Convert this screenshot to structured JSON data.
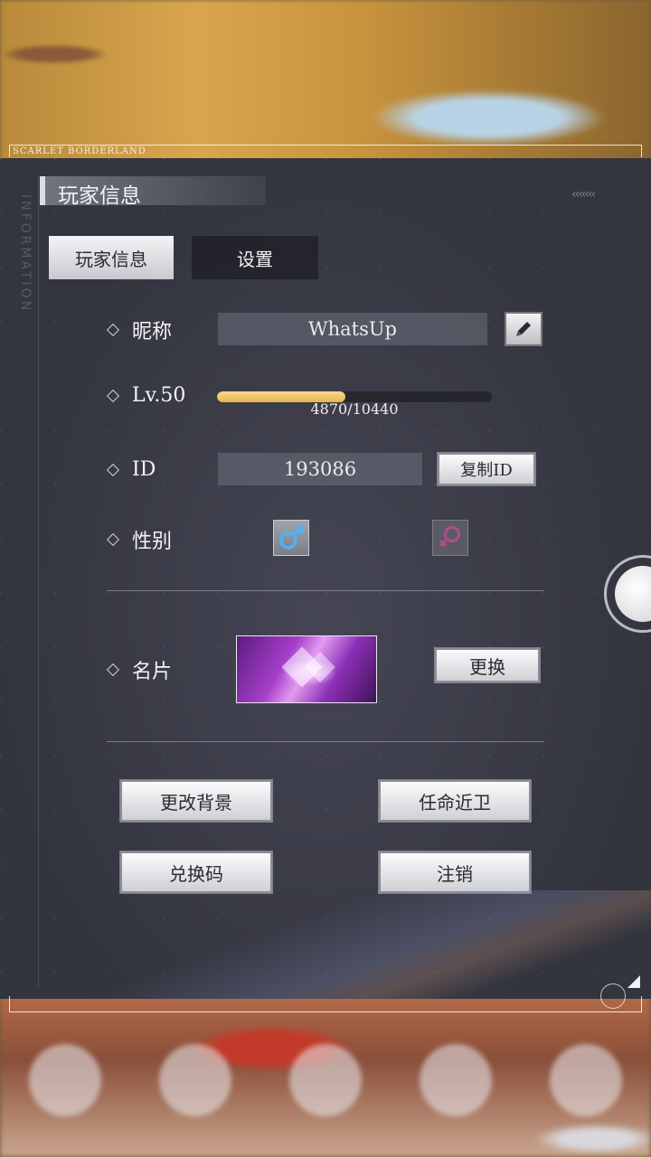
{
  "brand": "SCARLET BORDERLAND",
  "side_text": "INFORMATION",
  "panel": {
    "title": "玩家信息"
  },
  "tabs": [
    {
      "label": "玩家信息",
      "active": true
    },
    {
      "label": "设置",
      "active": false
    }
  ],
  "nickname": {
    "label": "昵称",
    "value": "WhatsUp",
    "edit_icon": "pencil-icon"
  },
  "level": {
    "label": "Lv.50",
    "exp_text": "4870/10440",
    "exp_current": 4870,
    "exp_max": 10440
  },
  "id_row": {
    "label": "ID",
    "value": "193086",
    "copy_label": "复制ID"
  },
  "gender": {
    "label": "性别",
    "male_icon": "male-symbol-icon",
    "female_icon": "female-symbol-icon",
    "selected": "male"
  },
  "card": {
    "label": "名片",
    "change_label": "更换"
  },
  "actions": {
    "change_bg": "更改背景",
    "appoint_guard": "任命近卫",
    "redeem_code": "兑换码",
    "logout": "注销"
  },
  "colors": {
    "exp_fill": "#e7b54c",
    "male_icon": "#4fb3f0",
    "female_icon": "#b04c8c"
  }
}
